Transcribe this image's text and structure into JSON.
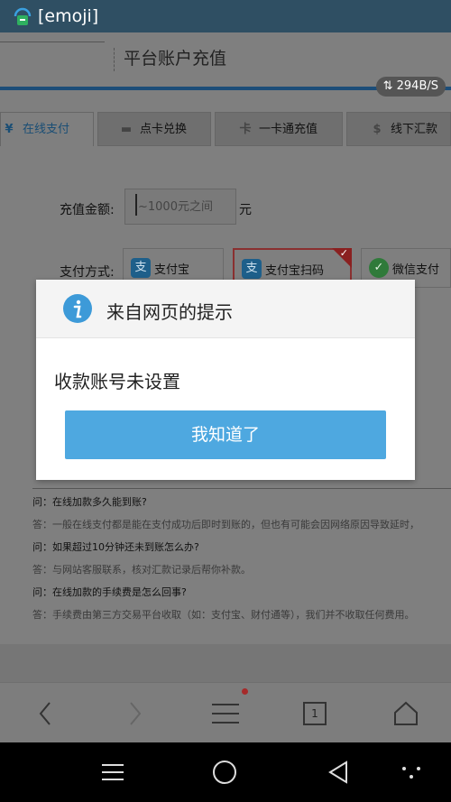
{
  "statusbar": {
    "title": "[emoji]"
  },
  "header": {
    "title": "平台账户充值",
    "speed": "294B/S"
  },
  "tabs": [
    {
      "icon": "yen-icon",
      "label": "在线支付"
    },
    {
      "icon": "card-icon",
      "label": "点卡兑换"
    },
    {
      "icon": "onecard-icon",
      "label": "一卡通充值"
    },
    {
      "icon": "dollar-icon",
      "label": "线下汇款"
    }
  ],
  "form": {
    "amount_label": "充值金额:",
    "amount_placeholder": "~1000元之间",
    "unit": "元",
    "method_label": "支付方式:",
    "methods": [
      "支付宝",
      "支付宝扫码",
      "微信支付"
    ]
  },
  "faq": [
    {
      "q": "问：在线加款多久能到账?",
      "a": "答：一般在线支付都是能在支付成功后即时到账的，但也有可能会因网络原因导致延时，"
    },
    {
      "q": "问：如果超过10分钟还未到账怎么办?",
      "a": "答：与网站客服联系，核对汇款记录后帮你补款。"
    },
    {
      "q": "问：在线加款的手续费是怎么回事?",
      "a": "答：手续费由第三方交易平台收取（如：支付宝、财付通等），我们并不收取任何费用。"
    }
  ],
  "browser": {
    "tab_count": "1"
  },
  "dialog": {
    "title": "来自网页的提示",
    "message": "收款账号未设置",
    "button": "我知道了"
  },
  "colors": {
    "accent": "#4ea8e0",
    "statusbar": "#2f4f63",
    "brand": "#1c4d78"
  }
}
